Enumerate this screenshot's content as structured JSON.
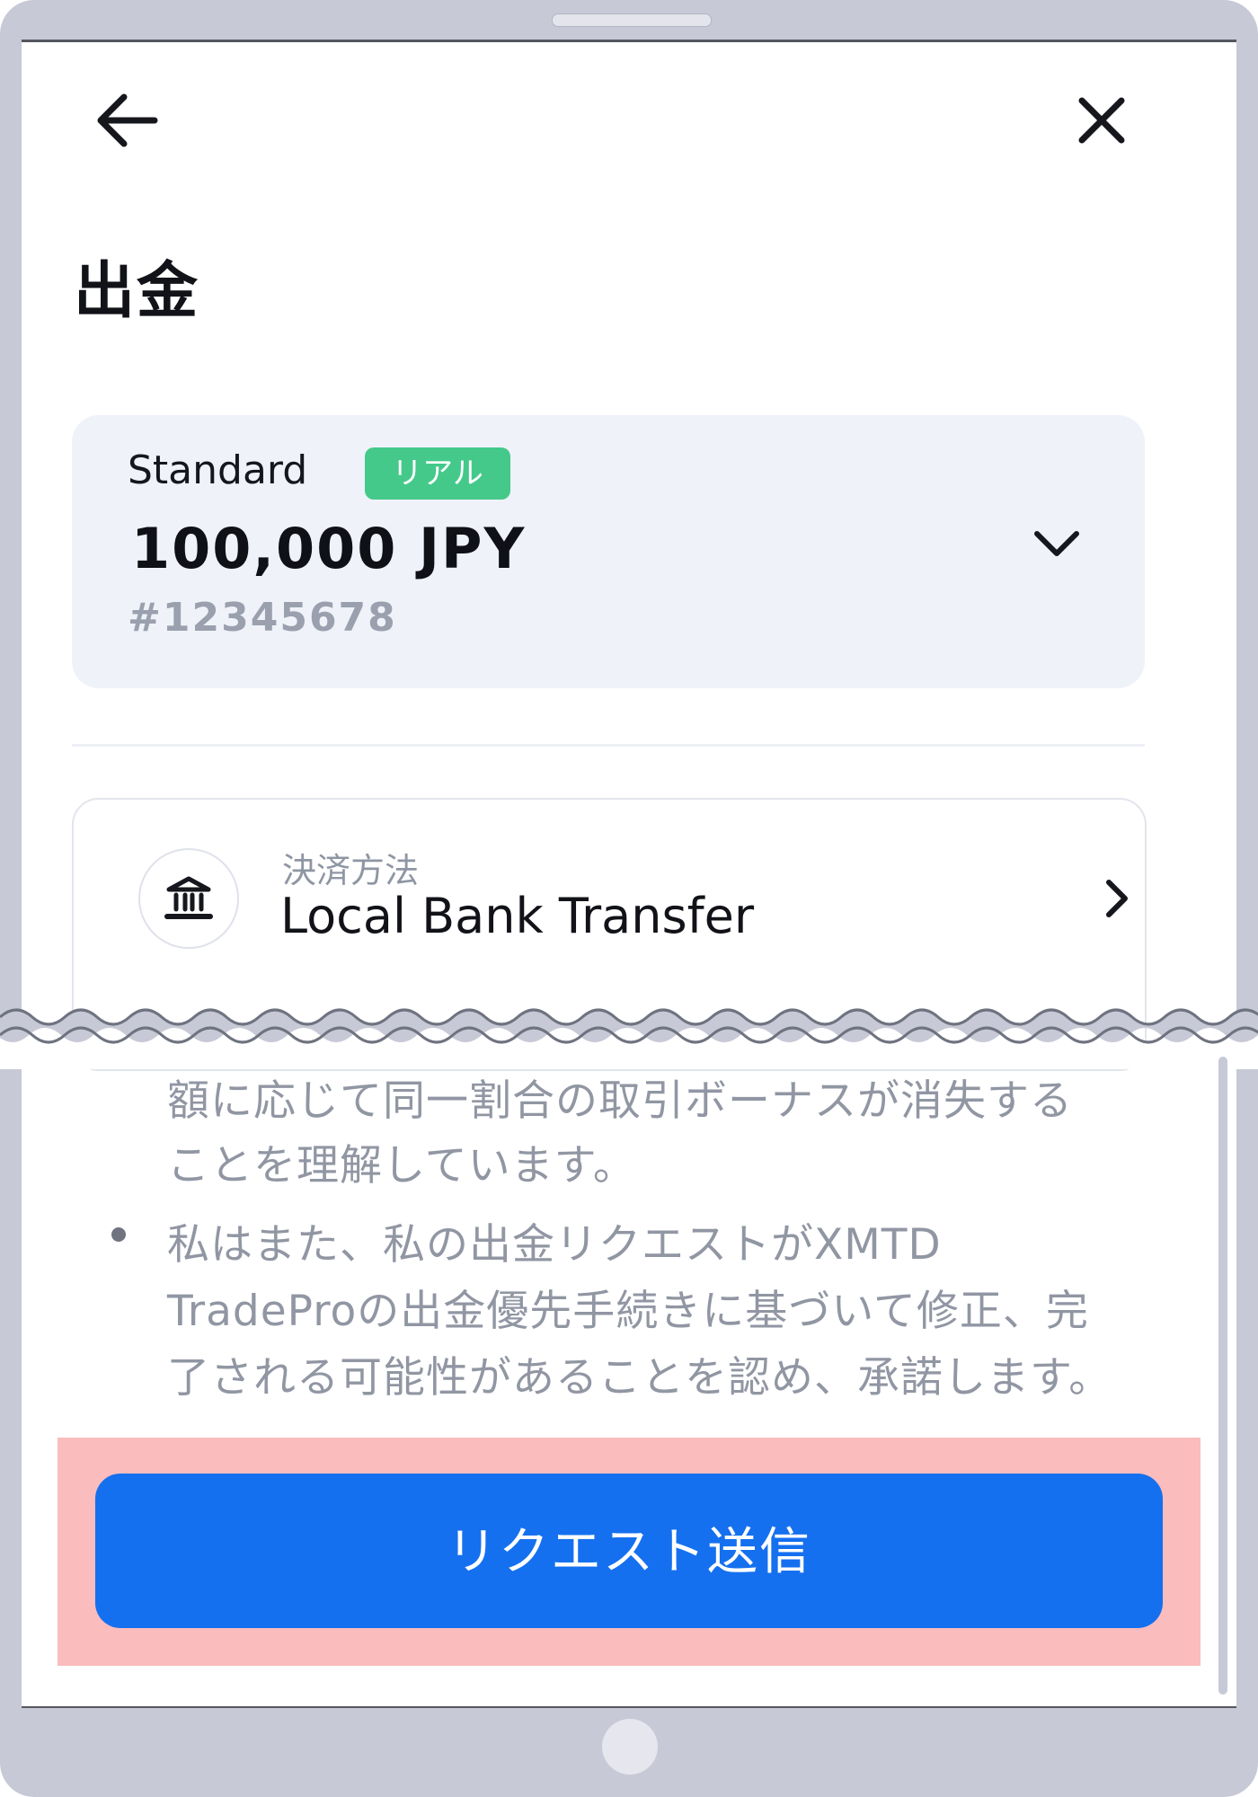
{
  "header": {
    "back_icon": "arrow-left-icon",
    "close_icon": "close-icon"
  },
  "page": {
    "title": "出金"
  },
  "account": {
    "type": "Standard",
    "badge": "リアル",
    "balance": "100,000 JPY",
    "number": "#12345678",
    "chevron_icon": "chevron-down-icon"
  },
  "payment": {
    "label": "決済方法",
    "value": "Local Bank Transfer",
    "icon": "bank-icon",
    "chevron_icon": "chevron-right-icon"
  },
  "terms": {
    "lines": [
      "額に応じて同一割合の取引ボーナスが消失する",
      "ことを理解しています。",
      "私はまた、私の出金リクエストがXMTD",
      "TradeProの出金優先手続きに基づいて修正、完",
      "了される可能性があることを認め、承諾します。"
    ]
  },
  "submit": {
    "label": "リクエスト送信"
  },
  "colors": {
    "frame": "#c8c9d6",
    "accent": "#1570ef",
    "badge": "#44c98a",
    "highlight": "#fbbcbd",
    "card_bg": "#eff2f8"
  }
}
